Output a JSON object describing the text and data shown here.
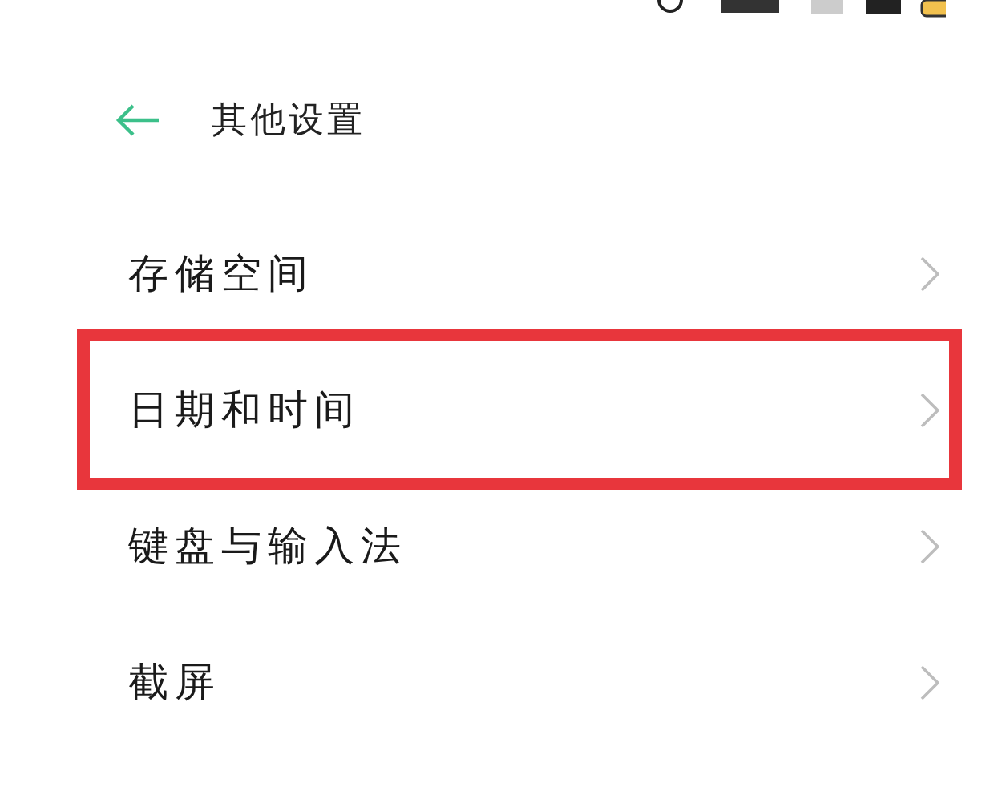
{
  "header": {
    "title": "其他设置"
  },
  "items": [
    {
      "label": "存储空间",
      "highlighted": false
    },
    {
      "label": "日期和时间",
      "highlighted": true
    },
    {
      "label": "键盘与输入法",
      "highlighted": false
    },
    {
      "label": "截屏",
      "highlighted": false
    }
  ]
}
